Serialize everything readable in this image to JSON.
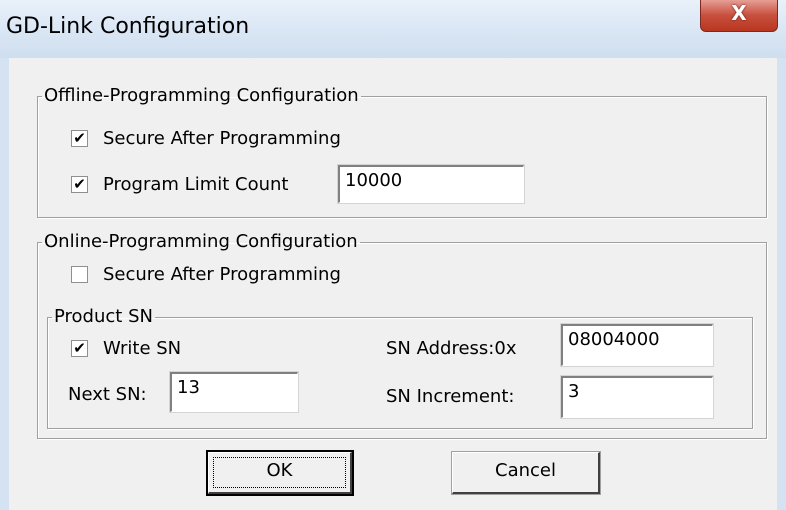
{
  "window": {
    "title": "GD-Link Configuration",
    "close_glyph": "X"
  },
  "offline": {
    "legend": "Offline-Programming Configuration",
    "secure_label": "Secure After Programming",
    "secure_checked": true,
    "limit_label": "Program Limit Count",
    "limit_checked": true,
    "limit_value": "10000"
  },
  "online": {
    "legend": "Online-Programming Configuration",
    "secure_label": "Secure After Programming",
    "secure_checked": false
  },
  "product_sn": {
    "legend": "Product SN",
    "write_label": "Write SN",
    "write_checked": true,
    "next_label": "Next SN:",
    "next_value": "13",
    "address_label": "SN Address:0x",
    "address_value": "08004000",
    "increment_label": "SN Increment:",
    "increment_value": "3"
  },
  "buttons": {
    "ok": "OK",
    "cancel": "Cancel"
  },
  "check_glyph": "✔"
}
